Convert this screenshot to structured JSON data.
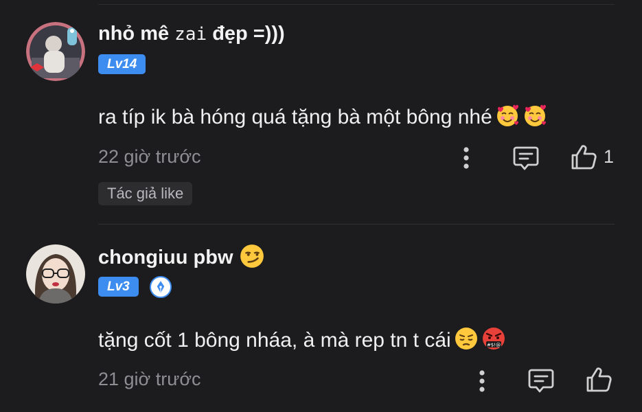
{
  "comments": [
    {
      "username_main": "nhỏ mê ",
      "username_mono": "zai",
      "username_tail": " đẹp =)))",
      "level": "Lv14",
      "text": "ra típ ik bà hóng quá tặng bà một bông nhé",
      "emojis": [
        "smiling-face-with-hearts",
        "smiling-face-with-hearts"
      ],
      "time": "22 giờ trước",
      "like_count": "1",
      "author_like_label": "Tác giả like"
    },
    {
      "username": "chongiuu pbw",
      "name_emoji": "smirking-face",
      "level": "Lv3",
      "badge_icon": "pen-nib-badge-icon",
      "text": "tặng cốt 1 bông nháa, à mà rep tn t cái",
      "emojis": [
        "pensive-face",
        "face-with-symbols-on-mouth"
      ],
      "time": "21 giờ trước"
    }
  ],
  "colors": {
    "background": "#1c1c1e",
    "level_badge": "#3d8cf0",
    "secondary_text": "#8e8e93",
    "chip_background": "#2d2d2f"
  }
}
